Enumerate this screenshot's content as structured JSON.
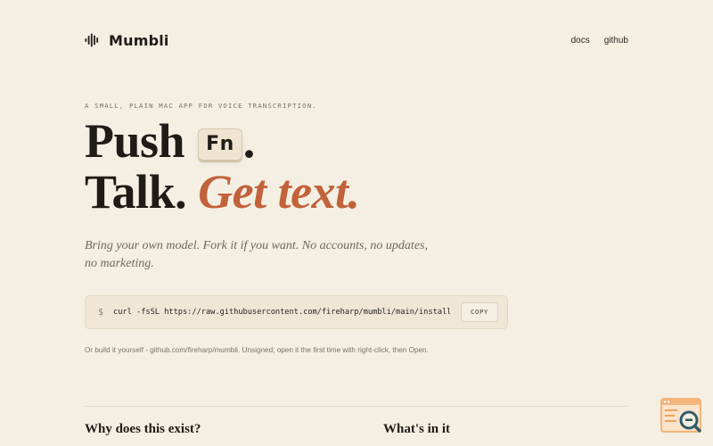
{
  "header": {
    "brand_name": "Mumbli",
    "brand_icon": "waveform-icon",
    "nav": [
      {
        "label": "docs"
      },
      {
        "label": "github"
      }
    ]
  },
  "hero": {
    "eyebrow": "A SMALL, PLAIN MAC APP FOR VOICE TRANSCRIPTION.",
    "line1_word": "Push",
    "key_label": "Fn",
    "line1_end": ".",
    "line2_word": "Talk.",
    "line2_accent": "Get text.",
    "tagline": "Bring your own model. Fork it if you want. No accounts, no updates, no marketing."
  },
  "install": {
    "prompt": "$",
    "command": "curl -fsSL https://raw.githubusercontent.com/fireharp/mumbli/main/install.sh | bash",
    "copy_label": "COPY"
  },
  "note": "Or build it yourself - github.com/fireharp/mumbli. Unsigned; open it the first time with right-click, then Open.",
  "sections": [
    {
      "title": "Why does this exist?"
    },
    {
      "title": "What's in it"
    }
  ],
  "colors": {
    "background": "#f5efe3",
    "text": "#1f1c18",
    "accent": "#c1623b",
    "muted": "#7a7164",
    "badge_orange": "#f0a45a",
    "badge_teal": "#2e5e66"
  },
  "corner_badge_icon": "search-window-icon"
}
